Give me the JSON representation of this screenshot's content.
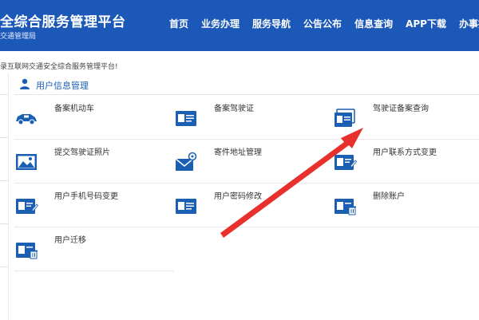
{
  "header": {
    "title": "全综合服务管理平台",
    "subtitle": "交通管理局",
    "nav": [
      "首页",
      "业务办理",
      "服务导航",
      "公告公布",
      "信息查询",
      "APP下载",
      "办事指南"
    ]
  },
  "welcome": "录互联网交通安全综合服务管理平台!",
  "section": {
    "title": "用户信息管理",
    "items": [
      {
        "label": "备案机动车",
        "icon": "car-icon"
      },
      {
        "label": "备案驾驶证",
        "icon": "license-card-icon"
      },
      {
        "label": "驾驶证备案查询",
        "icon": "license-search-icon"
      },
      {
        "label": "提交驾驶证照片",
        "icon": "photo-icon"
      },
      {
        "label": "寄件地址管理",
        "icon": "mail-location-icon"
      },
      {
        "label": "用户联系方式变更",
        "icon": "contact-edit-icon"
      },
      {
        "label": "用户手机号码变更",
        "icon": "phone-edit-icon"
      },
      {
        "label": "用户密码修改",
        "icon": "password-card-icon"
      },
      {
        "label": "删除账户",
        "icon": "delete-account-icon"
      },
      {
        "label": "用户迁移",
        "icon": "user-migrate-icon"
      }
    ]
  },
  "colors": {
    "header": "#1b58b8",
    "accent": "#1b5fb3",
    "annotation": "#e8312d"
  }
}
